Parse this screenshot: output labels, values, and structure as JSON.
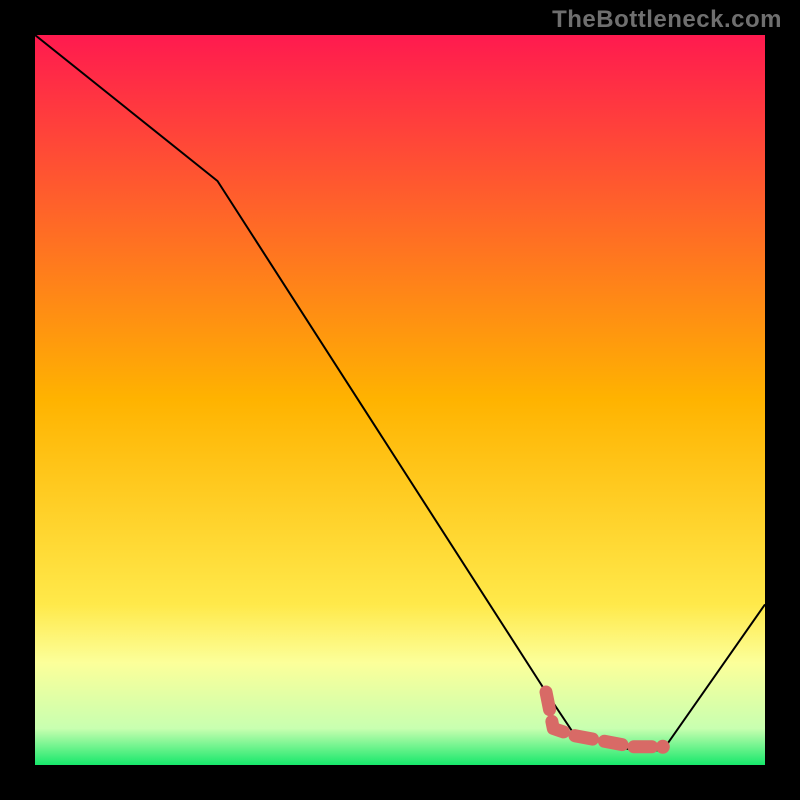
{
  "watermark": "TheBottleneck.com",
  "chart_data": {
    "type": "line",
    "title": "",
    "xlabel": "",
    "ylabel": "",
    "xlim": [
      0,
      100
    ],
    "ylim": [
      0,
      100
    ],
    "grid": false,
    "legend": false,
    "gradient_stops": [
      {
        "offset": 0.0,
        "color": "#ff1a4f"
      },
      {
        "offset": 0.5,
        "color": "#ffb300"
      },
      {
        "offset": 0.78,
        "color": "#ffe94a"
      },
      {
        "offset": 0.86,
        "color": "#fcff9a"
      },
      {
        "offset": 0.95,
        "color": "#c8ffb0"
      },
      {
        "offset": 1.0,
        "color": "#17e86b"
      }
    ],
    "series": [
      {
        "name": "bottleneck-curve",
        "type": "line",
        "x": [
          0,
          25,
          70,
          74,
          82,
          86,
          100
        ],
        "y": [
          100,
          80,
          10,
          4,
          2,
          2,
          22
        ]
      },
      {
        "name": "highlight-segment",
        "type": "line",
        "x": [
          70,
          71,
          74,
          82,
          86
        ],
        "y": [
          10,
          5,
          4,
          2.5,
          2.5
        ]
      }
    ],
    "colors": {
      "curve": "#000000",
      "highlight": "#d86a66"
    }
  }
}
